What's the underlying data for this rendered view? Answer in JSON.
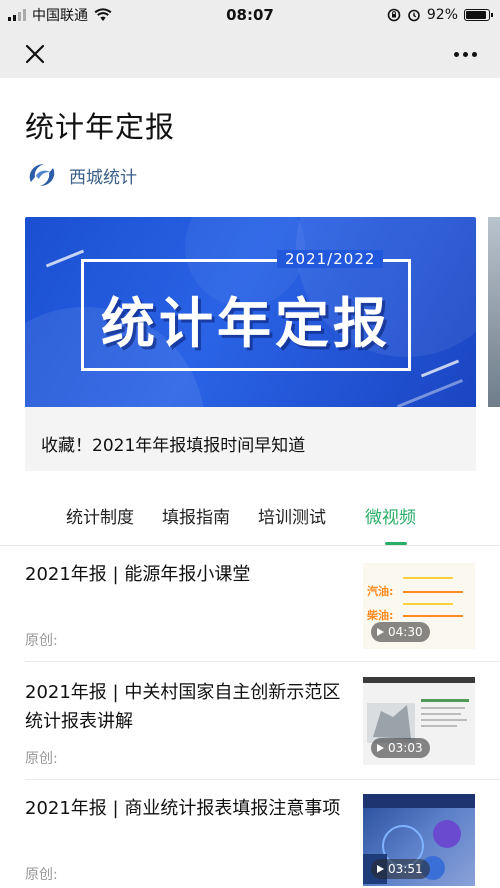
{
  "status_bar": {
    "carrier": "中国联通",
    "time": "08:07",
    "battery": "92%",
    "battery_level": 0.92
  },
  "nav": {
    "close_icon": "close-icon",
    "more_icon": "more-dots-icon"
  },
  "page": {
    "title": "统计年定报"
  },
  "account": {
    "name": "西城统计",
    "logo_icon": "xicheng-logo"
  },
  "banner": {
    "year_label": "2021/2022",
    "headline": "统计年定报",
    "caption": "收藏！2021年年报填报时间早知道"
  },
  "tabs": [
    {
      "label": "统计制度",
      "active": false
    },
    {
      "label": "填报指南",
      "active": false
    },
    {
      "label": "培训测试",
      "active": false
    },
    {
      "label": "微视频",
      "active": true
    }
  ],
  "articles": [
    {
      "title": "2021年报 | 能源年报小课堂",
      "meta": "原创:",
      "duration": "04:30",
      "thumb_text": [
        "汽油:",
        "柴油:"
      ]
    },
    {
      "title": "2021年报 | 中关村国家自主创新示范区统计报表讲解",
      "meta": "原创:",
      "duration": "03:03"
    },
    {
      "title": "2021年报 | 商业统计报表填报注意事项",
      "meta": "原创:",
      "duration": "03:51"
    }
  ],
  "colors": {
    "accent_green": "#2aae67",
    "account_blue": "#3a5e87",
    "banner_blue": "#2259dc"
  }
}
